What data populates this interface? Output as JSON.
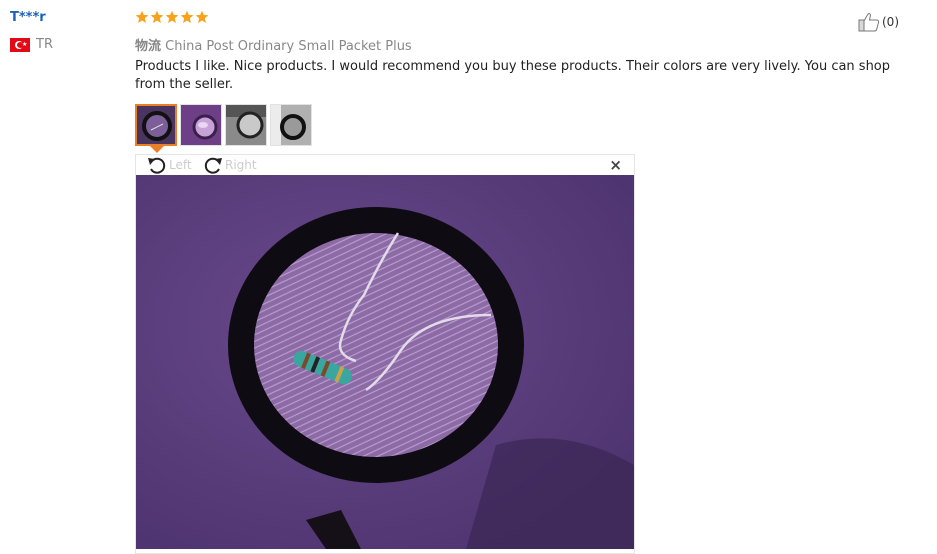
{
  "review": {
    "username": "T***r",
    "country": "TR",
    "rating": 5,
    "rating_max": 5,
    "shipping_label": "物流",
    "shipping_method": "China Post Ordinary Small Packet Plus",
    "text": "Products I like. Nice products. I would recommend you buy these products. Their colors are very lively. You can shop from the seller.",
    "helpful_count": "(0)"
  },
  "gallery": {
    "thumbnail_count": 4,
    "active_index": 0,
    "rotate_left_label": "Left",
    "rotate_right_label": "Right",
    "close_symbol": "×"
  },
  "colors": {
    "username": "#1c63b8",
    "star": "#f6a31b",
    "active_thumb_border": "#e8802a",
    "flag": "#e30a17",
    "photo_background": "#5d3f80"
  },
  "icons": {
    "flag": "turkey-flag-icon",
    "star": "star-icon",
    "helpful": "thumbs-up-icon",
    "rotate_left": "rotate-left-icon",
    "rotate_right": "rotate-right-icon",
    "close": "close-icon"
  }
}
